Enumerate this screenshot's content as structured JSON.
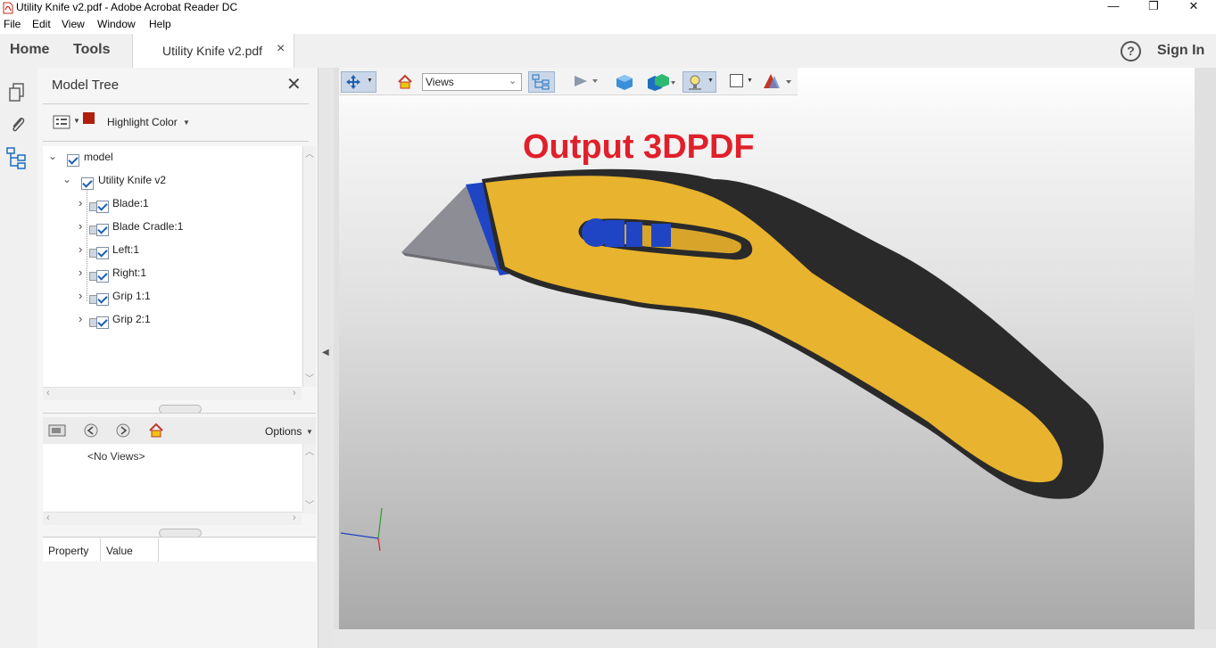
{
  "window": {
    "title": "Utility Knife v2.pdf - Adobe Acrobat Reader DC",
    "minimize": "—",
    "maximize": "❐",
    "close": "✕"
  },
  "menu": [
    "File",
    "Edit",
    "View",
    "Window",
    "Help"
  ],
  "tabs": {
    "home": "Home",
    "tools": "Tools",
    "document": "Utility Knife v2.pdf",
    "close": "×",
    "help": "?",
    "sign_in": "Sign In"
  },
  "model_tree": {
    "title": "Model Tree",
    "close": "✕",
    "highlight_color_label": "Highlight Color",
    "highlight_color": "#b01e0c",
    "nodes": [
      {
        "label": "model"
      },
      {
        "label": "Utility Knife v2"
      },
      {
        "label": "Blade:1"
      },
      {
        "label": "Blade Cradle:1"
      },
      {
        "label": "Left:1"
      },
      {
        "label": "Right:1"
      },
      {
        "label": "Grip 1:1"
      },
      {
        "label": "Grip 2:1"
      }
    ]
  },
  "views_panel": {
    "options_label": "Options",
    "empty_text": "<No Views>"
  },
  "properties": {
    "property_header": "Property",
    "value_header": "Value"
  },
  "toolbar3d": {
    "views_value": "Views"
  },
  "document": {
    "heading": "Output 3DPDF",
    "heading_color": "#e0202a",
    "knife_body_color": "#e8b32e",
    "knife_grip_color": "#2a2a2a",
    "blade_color": "#8d8d95",
    "slider_color": "#1f45c4"
  }
}
